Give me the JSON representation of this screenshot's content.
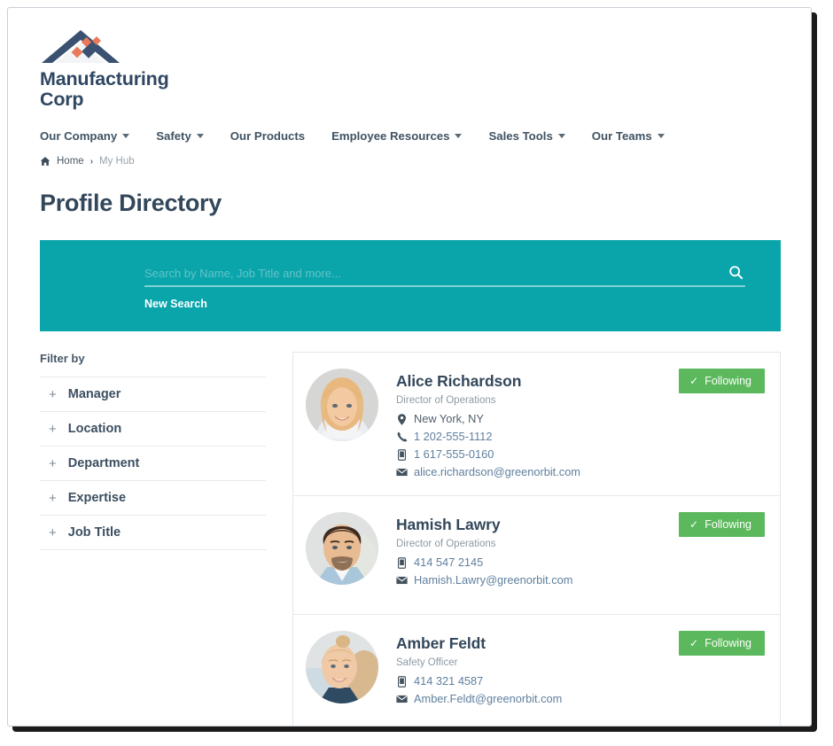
{
  "brand": {
    "name_line1": "Manufacturing",
    "name_line2": "Corp",
    "logo_navy": "#3b5172",
    "logo_accent": "#e8795a"
  },
  "nav": {
    "items": [
      {
        "label": "Our Company",
        "has_caret": true
      },
      {
        "label": "Safety",
        "has_caret": true
      },
      {
        "label": "Our Products",
        "has_caret": false
      },
      {
        "label": "Employee Resources",
        "has_caret": true
      },
      {
        "label": "Sales Tools",
        "has_caret": true
      },
      {
        "label": "Our Teams",
        "has_caret": true
      }
    ]
  },
  "breadcrumb": {
    "home": "Home",
    "separator": "›",
    "current": "My Hub"
  },
  "page": {
    "title": "Profile Directory"
  },
  "search": {
    "placeholder": "Search by Name, Job Title and more...",
    "value": "",
    "new_search_label": "New Search",
    "banner_color": "#0aa5ab"
  },
  "filters": {
    "heading": "Filter by",
    "items": [
      {
        "label": "Manager",
        "toggle": "+"
      },
      {
        "label": "Location",
        "toggle": "+"
      },
      {
        "label": "Department",
        "toggle": "+"
      },
      {
        "label": "Expertise",
        "toggle": "+"
      },
      {
        "label": "Job Title",
        "toggle": "+"
      }
    ]
  },
  "profiles": {
    "follow_label": "Following",
    "follow_color": "#5cb85c",
    "items": [
      {
        "name": "Alice Richardson",
        "job_title": "Director of Operations",
        "location": "New York, NY",
        "phone": "1 202-555-1112",
        "mobile": "1 617-555-0160",
        "email": "alice.richardson@greenorbit.com",
        "follow_label": "Following"
      },
      {
        "name": "Hamish Lawry",
        "job_title": "Director of Operations",
        "location": "",
        "phone": "",
        "mobile": "414 547 2145",
        "email": "Hamish.Lawry@greenorbit.com",
        "follow_label": "Following"
      },
      {
        "name": "Amber Feldt",
        "job_title": "Safety Officer",
        "location": "",
        "phone": "",
        "mobile": "414 321 4587",
        "email": "Amber.Feldt@greenorbit.com",
        "follow_label": "Following"
      }
    ]
  }
}
